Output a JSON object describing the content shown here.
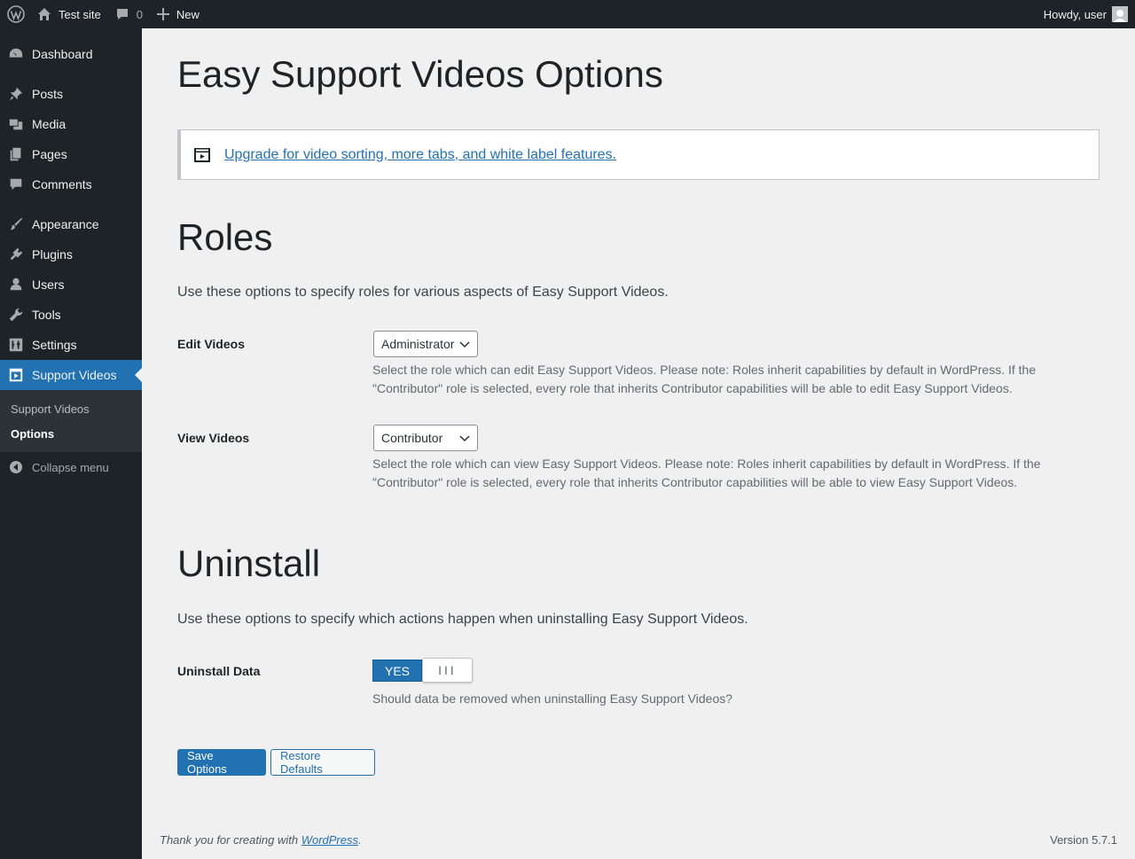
{
  "admin_bar": {
    "site_name": "Test site",
    "comments_count": "0",
    "new_label": "New",
    "greeting": "Howdy, user"
  },
  "sidebar": {
    "items": [
      {
        "label": "Dashboard",
        "icon": "dashboard-icon"
      },
      {
        "label": "Posts",
        "icon": "pin-icon"
      },
      {
        "label": "Media",
        "icon": "media-icon"
      },
      {
        "label": "Pages",
        "icon": "pages-icon"
      },
      {
        "label": "Comments",
        "icon": "comment-icon"
      },
      {
        "label": "Appearance",
        "icon": "brush-icon"
      },
      {
        "label": "Plugins",
        "icon": "plugin-icon"
      },
      {
        "label": "Users",
        "icon": "user-icon"
      },
      {
        "label": "Tools",
        "icon": "wrench-icon"
      },
      {
        "label": "Settings",
        "icon": "settings-icon"
      },
      {
        "label": "Support Videos",
        "icon": "video-icon",
        "current": true
      }
    ],
    "submenu": [
      {
        "label": "Support Videos"
      },
      {
        "label": "Options",
        "current": true
      }
    ],
    "collapse_label": "Collapse menu"
  },
  "main": {
    "title": "Easy Support Videos Options",
    "notice_link": "Upgrade for video sorting, more tabs, and white label features.",
    "roles": {
      "heading": "Roles",
      "description": "Use these options to specify roles for various aspects of Easy Support Videos.",
      "edit": {
        "label": "Edit Videos",
        "selected": "Administrator",
        "help": "Select the role which can edit Easy Support Videos. Please note: Roles inherit capabilities by default in WordPress. If the \"Contributor\" role is selected, every role that inherits Contributor capabilities will be able to edit Easy Support Videos."
      },
      "view": {
        "label": "View Videos",
        "selected": "Contributor",
        "help": "Select the role which can view Easy Support Videos. Please note: Roles inherit capabilities by default in WordPress. If the \"Contributor\" role is selected, every role that inherits Contributor capabilities will be able to view Easy Support Videos."
      }
    },
    "uninstall": {
      "heading": "Uninstall",
      "description": "Use these options to specify which actions happen when uninstalling Easy Support Videos.",
      "data": {
        "label": "Uninstall Data",
        "toggle_on_label": "YES",
        "toggle_handle": "III",
        "help": "Should data be removed when uninstalling Easy Support Videos?"
      }
    },
    "buttons": {
      "save": "Save Options",
      "restore": "Restore Defaults"
    }
  },
  "footer": {
    "thanks_prefix": "Thank you for creating with ",
    "thanks_link": "WordPress",
    "thanks_suffix": ".",
    "version": "Version 5.7.1"
  },
  "colors": {
    "accent": "#2271b1",
    "sidebar_bg": "#1d2327",
    "page_bg": "#f0f0f1"
  }
}
